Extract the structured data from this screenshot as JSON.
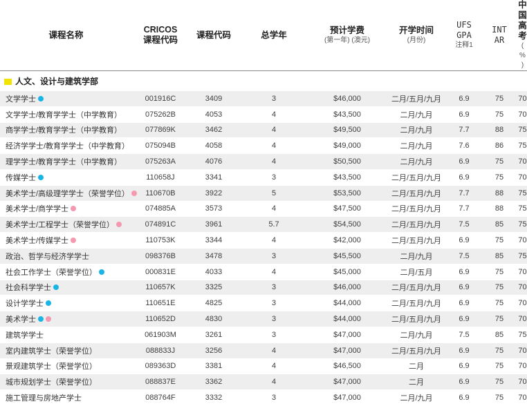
{
  "headers": {
    "name": "课程名称",
    "cricos_l1": "CRICOS",
    "cricos_l2": "课程代码",
    "code": "课程代码",
    "years": "总学年",
    "fee_l1": "预计学费",
    "fee_l2": "(第一年) (澳元)",
    "intake_l1": "开学时间",
    "intake_l2": "(月份)",
    "gpa_l1": "UFS GPA",
    "gpa_l2": "注释1",
    "int_l1": "INT",
    "int_l2": "AR",
    "gaokao_l1": "中国高考",
    "gaokao_l2": "( % )"
  },
  "section": {
    "title": "人文、设计与建筑学部",
    "marker_color": "#f2e400"
  },
  "legend_colors": {
    "blue": "#1ab5e6",
    "pink": "#f49ab0"
  },
  "rows": [
    {
      "name": "文学学士",
      "dots": [
        "blue"
      ],
      "cricos": "001916C",
      "code": "3409",
      "years": "3",
      "fee": "$46,000",
      "intake": "二月/五月/九月",
      "gpa": "6.9",
      "atar": "75",
      "gaokao": "70"
    },
    {
      "name": "文学学士/教育学学士（中学教育）",
      "dots": [],
      "cricos": "075262B",
      "code": "4053",
      "years": "4",
      "fee": "$43,500",
      "intake": "二月/九月",
      "gpa": "6.9",
      "atar": "75",
      "gaokao": "70"
    },
    {
      "name": "商学学士/教育学学士（中学教育）",
      "dots": [],
      "cricos": "077869K",
      "code": "3462",
      "years": "4",
      "fee": "$49,500",
      "intake": "二月/九月",
      "gpa": "7.7",
      "atar": "88",
      "gaokao": "75"
    },
    {
      "name": "经济学学士/教育学学士（中学教育）",
      "dots": [],
      "cricos": "075094B",
      "code": "4058",
      "years": "4",
      "fee": "$49,000",
      "intake": "二月/九月",
      "gpa": "7.6",
      "atar": "86",
      "gaokao": "75"
    },
    {
      "name": "理学学士/教育学学士（中学教育）",
      "dots": [],
      "cricos": "075263A",
      "code": "4076",
      "years": "4",
      "fee": "$50,500",
      "intake": "二月/九月",
      "gpa": "6.9",
      "atar": "75",
      "gaokao": "70"
    },
    {
      "name": "传媒学士",
      "dots": [
        "blue"
      ],
      "cricos": "110658J",
      "code": "3341",
      "years": "3",
      "fee": "$43,500",
      "intake": "二月/五月/九月",
      "gpa": "6.9",
      "atar": "75",
      "gaokao": "70"
    },
    {
      "name": "美术学士/高级理学学士（荣誉学位）",
      "dots": [
        "pink"
      ],
      "cricos": "110670B",
      "code": "3922",
      "years": "5",
      "fee": "$53,500",
      "intake": "二月/五月/九月",
      "gpa": "7.7",
      "atar": "88",
      "gaokao": "75"
    },
    {
      "name": "美术学士/商学学士",
      "dots": [
        "pink"
      ],
      "cricos": "074885A",
      "code": "3573",
      "years": "4",
      "fee": "$47,500",
      "intake": "二月/五月/九月",
      "gpa": "7.7",
      "atar": "88",
      "gaokao": "75"
    },
    {
      "name": "美术学士/工程学士（荣誉学位）",
      "dots": [
        "pink"
      ],
      "cricos": "074891C",
      "code": "3961",
      "years": "5.7",
      "fee": "$54,500",
      "intake": "二月/五月/九月",
      "gpa": "7.5",
      "atar": "85",
      "gaokao": "75"
    },
    {
      "name": "美术学士/传媒学士",
      "dots": [
        "pink"
      ],
      "cricos": "110753K",
      "code": "3344",
      "years": "4",
      "fee": "$42,000",
      "intake": "二月/五月/九月",
      "gpa": "6.9",
      "atar": "75",
      "gaokao": "70"
    },
    {
      "name": "政治、哲学与经济学学士",
      "dots": [],
      "cricos": "098376B",
      "code": "3478",
      "years": "3",
      "fee": "$45,500",
      "intake": "二月/九月",
      "gpa": "7.5",
      "atar": "85",
      "gaokao": "75"
    },
    {
      "name": "社会工作学士（荣誉学位）",
      "dots": [
        "blue"
      ],
      "cricos": "000831E",
      "code": "4033",
      "years": "4",
      "fee": "$45,000",
      "intake": "二月/五月",
      "gpa": "6.9",
      "atar": "75",
      "gaokao": "70"
    },
    {
      "name": "社会科学学士",
      "dots": [
        "blue"
      ],
      "cricos": "110657K",
      "code": "3325",
      "years": "3",
      "fee": "$46,000",
      "intake": "二月/五月/九月",
      "gpa": "6.9",
      "atar": "75",
      "gaokao": "70"
    },
    {
      "name": "设计学学士",
      "dots": [
        "blue"
      ],
      "cricos": "110651E",
      "code": "4825",
      "years": "3",
      "fee": "$44,000",
      "intake": "二月/五月/九月",
      "gpa": "6.9",
      "atar": "75",
      "gaokao": "70"
    },
    {
      "name": "美术学士",
      "dots": [
        "blue",
        "pink"
      ],
      "cricos": "110652D",
      "code": "4830",
      "years": "3",
      "fee": "$44,000",
      "intake": "二月/五月/九月",
      "gpa": "6.9",
      "atar": "75",
      "gaokao": "70"
    },
    {
      "name": "建筑学学士",
      "dots": [],
      "cricos": "061903M",
      "code": "3261",
      "years": "3",
      "fee": "$47,000",
      "intake": "二月/九月",
      "gpa": "7.5",
      "atar": "85",
      "gaokao": "75"
    },
    {
      "name": "室内建筑学士（荣誉学位）",
      "dots": [],
      "cricos": "088833J",
      "code": "3256",
      "years": "4",
      "fee": "$47,000",
      "intake": "二月/五月/九月",
      "gpa": "6.9",
      "atar": "75",
      "gaokao": "70"
    },
    {
      "name": "景观建筑学士（荣誉学位）",
      "dots": [],
      "cricos": "089363D",
      "code": "3381",
      "years": "4",
      "fee": "$46,500",
      "intake": "二月",
      "gpa": "6.9",
      "atar": "75",
      "gaokao": "70"
    },
    {
      "name": "城市规划学士（荣誉学位）",
      "dots": [],
      "cricos": "088837E",
      "code": "3362",
      "years": "4",
      "fee": "$47,000",
      "intake": "二月",
      "gpa": "6.9",
      "atar": "75",
      "gaokao": "70"
    },
    {
      "name": "施工管理与房地产学士",
      "dots": [],
      "cricos": "088764F",
      "code": "3332",
      "years": "3",
      "fee": "$47,000",
      "intake": "二月/九月",
      "gpa": "6.9",
      "atar": "75",
      "gaokao": "70"
    }
  ]
}
